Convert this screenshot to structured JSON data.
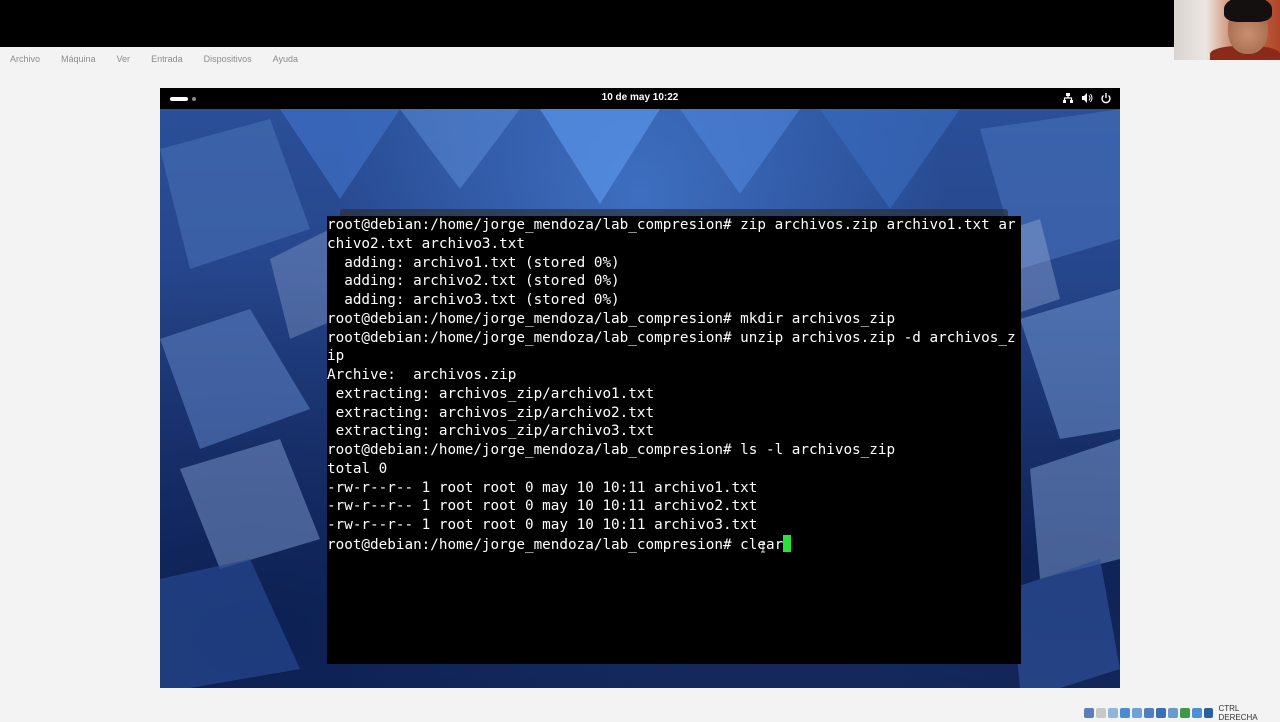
{
  "host": {
    "menu": [
      "Archivo",
      "Máquina",
      "Ver",
      "Entrada",
      "Dispositivos",
      "Ayuda"
    ],
    "host_key": "CTRL DERECHA"
  },
  "guest": {
    "top_bar": {
      "clock": "10 de may  10:22",
      "tray_icons": [
        "network-icon",
        "volume-icon",
        "power-icon"
      ]
    },
    "terminal": {
      "lines": [
        "root@debian:/home/jorge_mendoza/lab_compresion# zip archivos.zip archivo1.txt ar",
        "chivo2.txt archivo3.txt",
        "  adding: archivo1.txt (stored 0%)",
        "  adding: archivo2.txt (stored 0%)",
        "  adding: archivo3.txt (stored 0%)",
        "root@debian:/home/jorge_mendoza/lab_compresion# mkdir archivos_zip",
        "root@debian:/home/jorge_mendoza/lab_compresion# unzip archivos.zip -d archivos_z",
        "ip",
        "Archive:  archivos.zip",
        " extracting: archivos_zip/archivo1.txt",
        " extracting: archivos_zip/archivo2.txt",
        " extracting: archivos_zip/archivo3.txt",
        "root@debian:/home/jorge_mendoza/lab_compresion# ls -l archivos_zip",
        "total 0",
        "-rw-r--r-- 1 root root 0 may 10 10:11 archivo1.txt",
        "-rw-r--r-- 1 root root 0 may 10 10:11 archivo2.txt",
        "-rw-r--r-- 1 root root 0 may 10 10:11 archivo3.txt"
      ],
      "prompt": "root@debian:/home/jorge_mendoza/lab_compresion# ",
      "current_input": "clear",
      "cursor_color": "#27e33c"
    }
  }
}
